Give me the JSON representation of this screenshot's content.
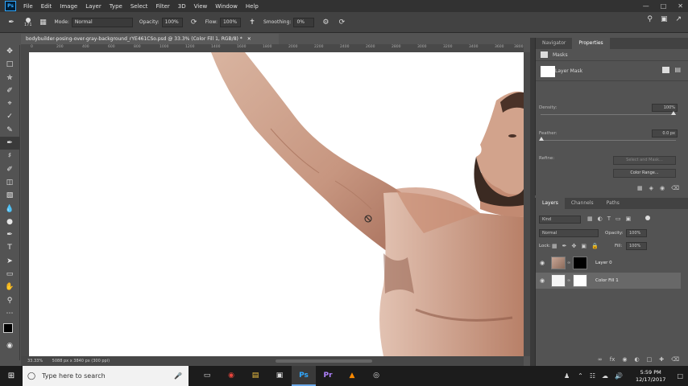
{
  "menubar": {
    "logo": "Ps",
    "items": [
      "File",
      "Edit",
      "Image",
      "Layer",
      "Type",
      "Select",
      "Filter",
      "3D",
      "View",
      "Window",
      "Help"
    ]
  },
  "options": {
    "brush_size": "171",
    "mode_label": "Mode:",
    "mode_value": "Normal",
    "opacity_label": "Opacity:",
    "opacity_value": "100%",
    "flow_label": "Flow:",
    "flow_value": "100%",
    "smoothing_label": "Smoothing:",
    "smoothing_value": "0%"
  },
  "document": {
    "tab_title": "bodybuilder-posing-over-gray-background_rYE461CSo.psd @ 33.3% (Color Fill 1, RGB/8) *",
    "ruler_labels": [
      "0",
      "200",
      "400",
      "600",
      "800",
      "1000",
      "1200",
      "1400",
      "1600",
      "1800",
      "2000",
      "2200",
      "2400",
      "2600",
      "2800",
      "3000",
      "3200",
      "3400",
      "3600",
      "3800"
    ],
    "zoom": "33.33%",
    "doc_info": "5088 px x 3840 px (300 ppi)"
  },
  "properties": {
    "tabs": [
      "Navigator",
      "Properties"
    ],
    "section": "Masks",
    "mask_type": "Layer Mask",
    "density_label": "Density:",
    "density_value": "100%",
    "feather_label": "Feather:",
    "feather_value": "0.0 px",
    "refine_label": "Refine:",
    "select_mask_btn": "Select and Mask...",
    "color_range_btn": "Color Range..."
  },
  "layers": {
    "tabs": [
      "Layers",
      "Channels",
      "Paths"
    ],
    "kind": "Kind",
    "blend": "Normal",
    "opacity_label": "Opacity:",
    "opacity_value": "100%",
    "lock_label": "Lock:",
    "fill_label": "Fill:",
    "fill_value": "100%",
    "items": [
      {
        "name": "Layer 0"
      },
      {
        "name": "Color Fill 1"
      }
    ]
  },
  "taskbar": {
    "search_placeholder": "Type here to search",
    "time": "5:59 PM",
    "date": "12/17/2017"
  }
}
